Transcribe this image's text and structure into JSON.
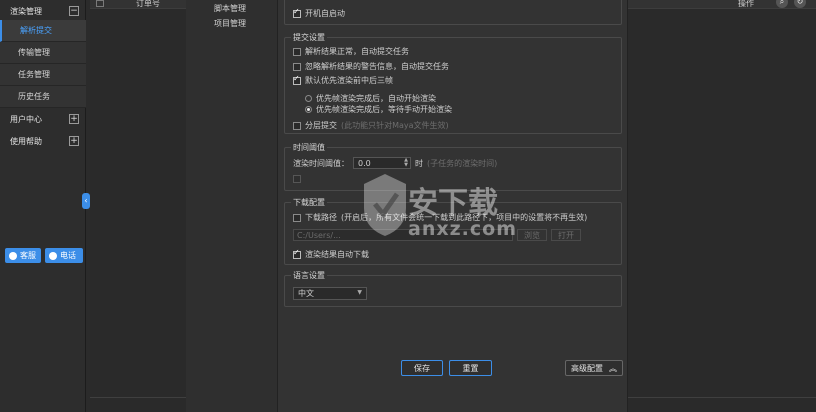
{
  "sidebar": {
    "render_management": "渲染管理",
    "items": [
      {
        "label": "解析提交",
        "active": true
      },
      {
        "label": "传输管理"
      },
      {
        "label": "任务管理"
      },
      {
        "label": "历史任务"
      }
    ],
    "user_center": "用户中心",
    "help": "使用帮助",
    "support": {
      "qq": "客服",
      "phone": "电话"
    },
    "colors": {
      "accent": "#3c8ee8"
    }
  },
  "table": {
    "col_order": "订单号",
    "col_action": "操作"
  },
  "settings_nav": {
    "items": [
      "脚本管理",
      "项目管理"
    ]
  },
  "dialog": {
    "startup": {
      "label": "开机自启动",
      "checked": true
    },
    "submit": {
      "title": "提交设置",
      "parse_normal": "解析结果正常，自动提交任务",
      "ignore_warning": "忽略解析结果的警告信息，自动提交任务",
      "priority_frames": "默认优先渲染前中后三帧",
      "auto_start": "优先帧渲染完成后，自动开始渲染",
      "wait_manual": "优先帧渲染完成后，等待手动开始渲染",
      "layer_submit": "分层提交",
      "layer_hint": "(此功能只针对Maya文件生效)"
    },
    "timeout": {
      "title": "时间阈值",
      "label": "渲染时间阈值：",
      "value": "0.0",
      "unit": "时",
      "hint": "(子任务的渲染时间)"
    },
    "download": {
      "title": "下载配置",
      "path_label": "下载路径",
      "path_hint": "(开启后，所有文件会统一下载到此路径下，项目中的设置将不再生效)",
      "path_value": "C:/Users/...",
      "browse": "浏览",
      "open": "打开",
      "auto_download": "渲染结果自动下载"
    },
    "language": {
      "title": "语言设置",
      "value": "中文"
    },
    "buttons": {
      "save": "保存",
      "reset": "重置",
      "advanced": "高级配置"
    }
  },
  "watermark": {
    "name": "安下载",
    "domain": "anxz.com"
  }
}
